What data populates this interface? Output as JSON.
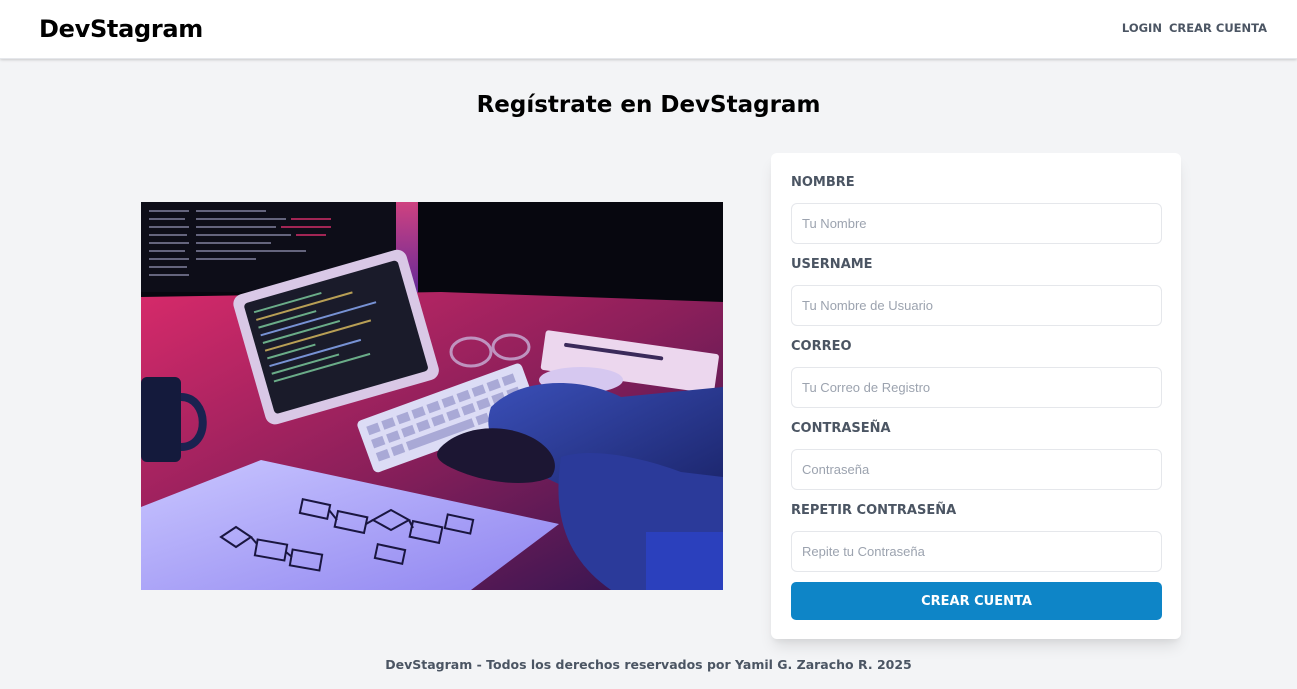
{
  "header": {
    "logo": "DevStagram",
    "nav": {
      "login": "LOGIN",
      "register": "CREAR CUENTA"
    }
  },
  "main": {
    "title": "Regístrate en DevStagram",
    "hero_image": {
      "subject": "developer typing at desk with monitor, tablet and flowchart sketch",
      "palette": [
        "#0a0a14",
        "#e0306e",
        "#5a6cff",
        "#8a3fd1"
      ]
    },
    "form": {
      "fields": [
        {
          "label": "NOMBRE",
          "placeholder": "Tu Nombre",
          "value": ""
        },
        {
          "label": "USERNAME",
          "placeholder": "Tu Nombre de Usuario",
          "value": ""
        },
        {
          "label": "CORREO",
          "placeholder": "Tu Correo de Registro",
          "value": ""
        },
        {
          "label": "CONTRASEÑA",
          "placeholder": "Contraseña",
          "value": ""
        },
        {
          "label": "REPETIR CONTRASEÑA",
          "placeholder": "Repite tu Contraseña",
          "value": ""
        }
      ],
      "submit_label": "CREAR CUENTA"
    }
  },
  "footer": {
    "text": "DevStagram - Todos los derechos reservados por Yamil G. Zaracho R. 2025"
  },
  "colors": {
    "accent": "#0e85c7",
    "background": "#f3f4f6",
    "label": "#4b5563"
  }
}
